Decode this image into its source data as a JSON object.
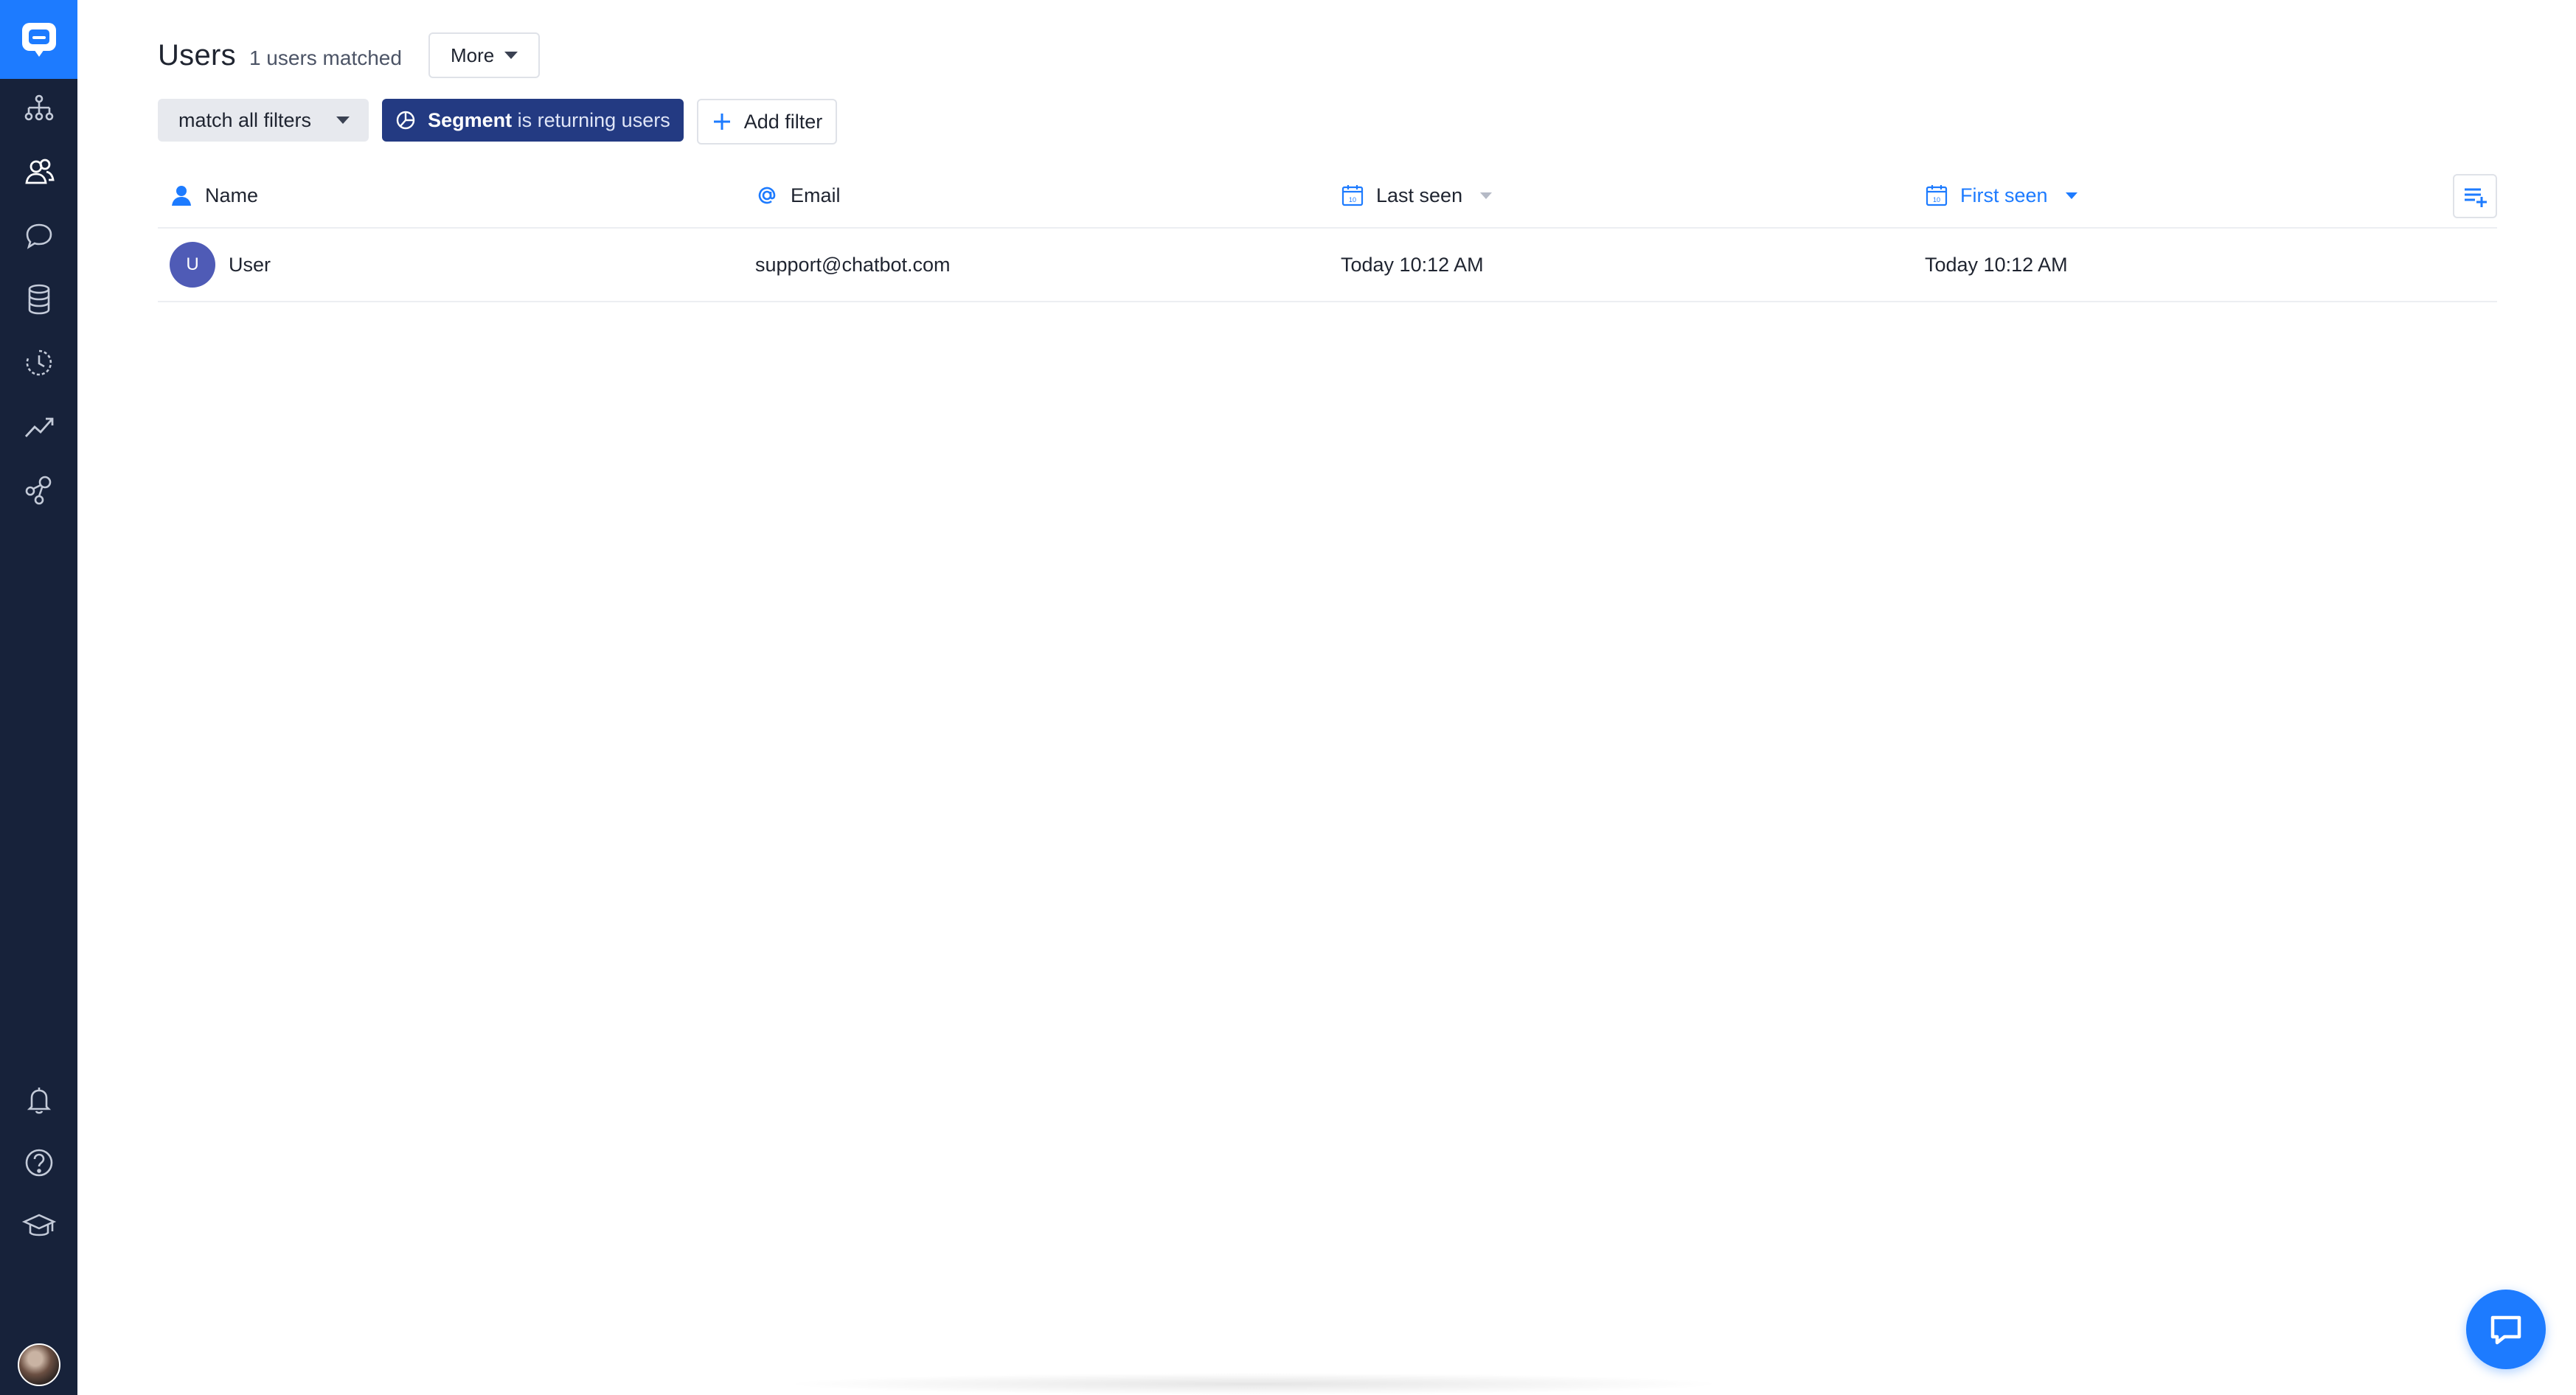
{
  "sidebar": {
    "logo": "chat-logo-icon",
    "items": [
      {
        "name": "bot-flows",
        "icon": "sitemap-icon",
        "active": false
      },
      {
        "name": "users",
        "icon": "users-icon",
        "active": true
      },
      {
        "name": "chats",
        "icon": "chat-bubble-icon",
        "active": false
      },
      {
        "name": "database",
        "icon": "database-icon",
        "active": false
      },
      {
        "name": "history",
        "icon": "history-icon",
        "active": false
      },
      {
        "name": "reports",
        "icon": "trend-icon",
        "active": false
      },
      {
        "name": "integrations",
        "icon": "integrations-icon",
        "active": false
      }
    ],
    "bottom_items": [
      {
        "name": "notifications",
        "icon": "bell-icon"
      },
      {
        "name": "help",
        "icon": "help-icon"
      },
      {
        "name": "academy",
        "icon": "graduation-cap-icon"
      }
    ]
  },
  "header": {
    "title": "Users",
    "match_count": "1 users matched",
    "more_label": "More"
  },
  "filters": {
    "match_label": "match all filters",
    "segment_key": "Segment",
    "segment_rest": "is returning users",
    "add_label": "Add filter"
  },
  "table": {
    "columns": [
      {
        "label": "Name",
        "icon": "person-icon"
      },
      {
        "label": "Email",
        "icon": "at-icon"
      },
      {
        "label": "Last seen",
        "icon": "calendar-icon"
      },
      {
        "label": "First seen",
        "icon": "calendar-icon"
      }
    ],
    "rows": [
      {
        "initial": "U",
        "name": "User",
        "email": "support@chatbot.com",
        "last_seen": "Today 10:12 AM",
        "first_seen": "Today 10:12 AM"
      }
    ]
  },
  "colors": {
    "sidebar_bg": "#17223a",
    "accent": "#1d7bff",
    "segment_chip": "#233a82",
    "row_avatar": "#4f5bb6"
  }
}
